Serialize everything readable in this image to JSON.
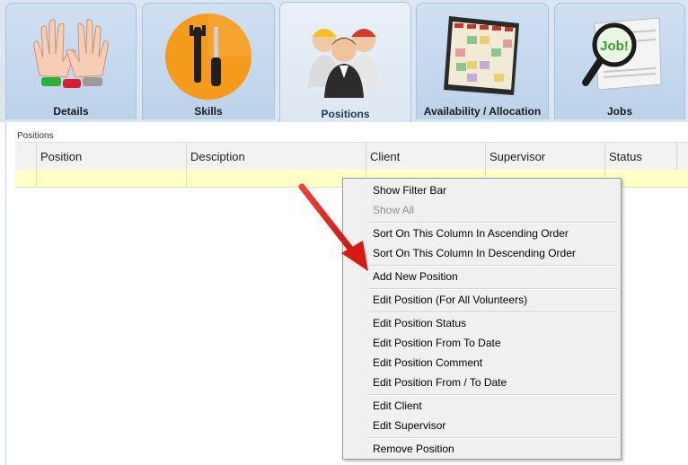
{
  "tabs": [
    {
      "label": "Details",
      "icon": "hands-icon"
    },
    {
      "label": "Skills",
      "icon": "tools-icon"
    },
    {
      "label": "Positions",
      "icon": "workers-icon",
      "active": true
    },
    {
      "label": "Availability / Allocation",
      "icon": "calendar-icon"
    },
    {
      "label": "Jobs",
      "icon": "job-search-icon"
    }
  ],
  "panel": {
    "caption": "Positions",
    "columns": [
      "Position",
      "Desciption",
      "Client",
      "Supervisor",
      "Status"
    ]
  },
  "context_menu": {
    "items": {
      "show_filter_bar": "Show Filter Bar",
      "show_all": "Show All",
      "sort_asc": "Sort On This Column In Ascending Order",
      "sort_desc": "Sort On This Column In Descending Order",
      "add_new_position": "Add New Position",
      "edit_position_all": "Edit Position (For All Volunteers)",
      "edit_position_status": "Edit Position Status",
      "edit_position_from_to": "Edit Position From To Date",
      "edit_position_comment": "Edit Position Comment",
      "edit_position_from_slash_to": "Edit Position From / To Date",
      "edit_client": "Edit Client",
      "edit_supervisor": "Edit Supervisor",
      "remove_position": "Remove Position"
    }
  },
  "colors": {
    "tab_bg": "#c6daef",
    "active_tab_label": "#16385e",
    "selected_row": "#ffffc8",
    "menu_bg": "#f0f0f0",
    "annotation_arrow": "#e3191b"
  }
}
